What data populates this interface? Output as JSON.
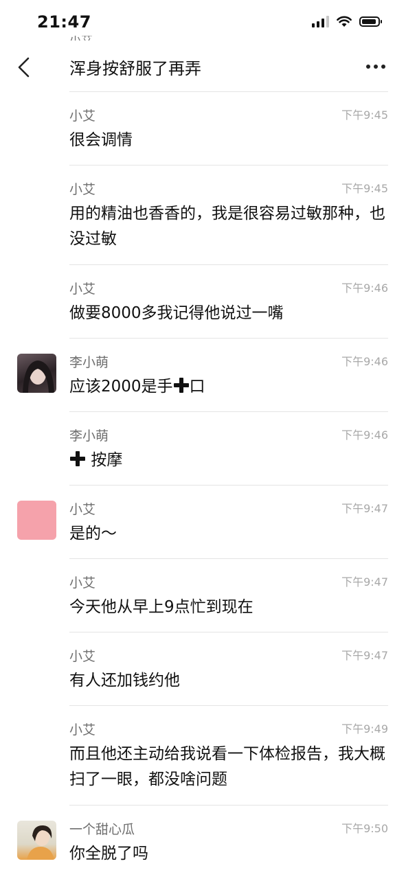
{
  "status_bar": {
    "time": "21:47",
    "battery_level": 0.8,
    "signal_bars": 3
  },
  "header": {
    "prev_sender_partial": "小艾",
    "title": "浑身按舒服了再弄",
    "more_icon": "more-dots-icon",
    "back_icon": "chevron-left-icon"
  },
  "messages": [
    {
      "sender": "小艾",
      "time": "下午9:45",
      "text": "很会调情"
    },
    {
      "sender": "小艾",
      "time": "下午9:45",
      "text": "用的精油也香香的，我是很容易过敏那种，也没过敏"
    },
    {
      "sender": "小艾",
      "time": "下午9:46",
      "text": "做要8000多我记得他说过一嘴"
    },
    {
      "sender": "李小萌",
      "time": "下午9:46",
      "text_before": "应该2000是手",
      "text_after": "口"
    },
    {
      "sender": "李小萌",
      "time": "下午9:46",
      "text_after": "按摩"
    },
    {
      "sender": "小艾",
      "time": "下午9:47",
      "text": "是的～"
    },
    {
      "sender": "小艾",
      "time": "下午9:47",
      "text": "今天他从早上9点忙到现在"
    },
    {
      "sender": "小艾",
      "time": "下午9:47",
      "text": "有人还加钱约他"
    },
    {
      "sender": "小艾",
      "time": "下午9:49",
      "text": "而且他还主动给我说看一下体检报告，我大概扫了一眼，都没啥问题"
    },
    {
      "sender": "一个甜心瓜",
      "time": "下午9:50",
      "text": "你全脱了吗"
    }
  ]
}
